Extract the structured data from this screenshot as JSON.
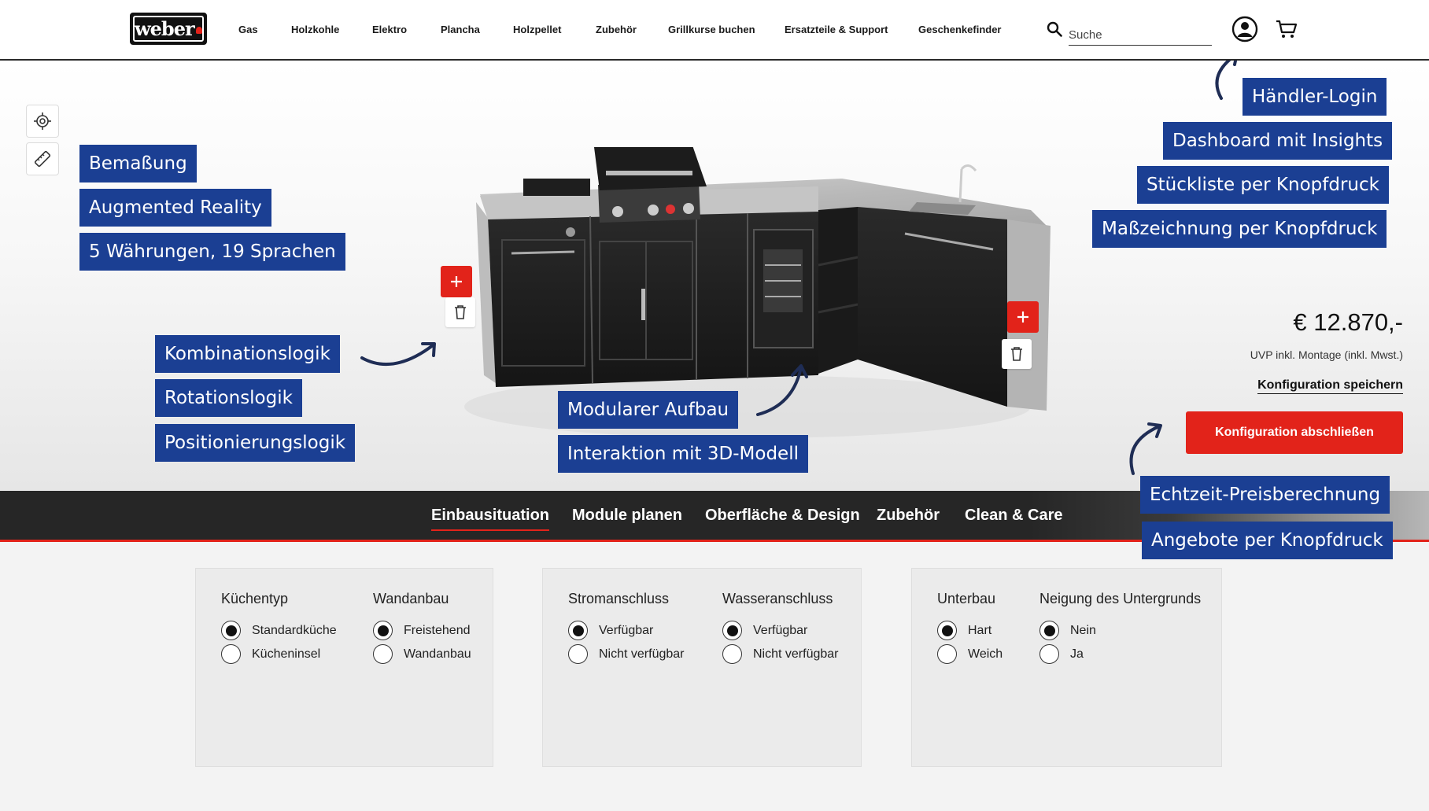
{
  "header": {
    "logo_text": "weber",
    "nav": [
      "Gas",
      "Holzkohle",
      "Elektro",
      "Plancha",
      "Holzpellet",
      "Zubehör",
      "Grillkurse buchen",
      "Ersatzteile & Support",
      "Geschenkefinder"
    ],
    "search_placeholder": "Suche",
    "icons": {
      "search": "search-icon",
      "account": "user-icon",
      "cart": "cart-icon"
    }
  },
  "tools": {
    "icons": [
      "target-icon",
      "ruler-icon"
    ]
  },
  "annotations": {
    "left": [
      "Bemaßung",
      "Augmented Reality",
      "5 Währungen, 19 Sprachen"
    ],
    "logic": [
      "Kombinationslogik",
      "Rotationslogik",
      "Positionierungslogik"
    ],
    "center": [
      "Modularer Aufbau",
      "Interaktion mit 3D-Modell"
    ],
    "right": [
      "Händler-Login",
      "Dashboard mit Insights",
      "Stückliste per Knopfdruck",
      "Maßzeichnung per Knopfdruck"
    ],
    "bottom_right": [
      "Echtzeit-Preisberechnung",
      "Angebote per Knopfdruck"
    ]
  },
  "pricing": {
    "price": "€ 12.870,-",
    "note": "UVP inkl. Montage (inkl. Mwst.)",
    "save_label": "Konfiguration speichern",
    "finish_label": "Konfiguration abschließen"
  },
  "tabs": [
    "Einbausituation",
    "Module planen",
    "Oberfläche & Design",
    "Zubehör",
    "Clean & Care"
  ],
  "active_tab": "Einbausituation",
  "panels": [
    {
      "groups": [
        {
          "title": "Küchentyp",
          "options": [
            "Standardküche",
            "Kücheninsel"
          ],
          "selected": "Standardküche"
        },
        {
          "title": "Wandanbau",
          "options": [
            "Freistehend",
            "Wandanbau"
          ],
          "selected": "Freistehend"
        }
      ]
    },
    {
      "groups": [
        {
          "title": "Stromanschluss",
          "options": [
            "Verfügbar",
            "Nicht verfügbar"
          ],
          "selected": "Verfügbar"
        },
        {
          "title": "Wasseranschluss",
          "options": [
            "Verfügbar",
            "Nicht verfügbar"
          ],
          "selected": "Verfügbar"
        }
      ]
    },
    {
      "groups": [
        {
          "title": "Unterbau",
          "options": [
            "Hart",
            "Weich"
          ],
          "selected": "Hart"
        },
        {
          "title": "Neigung des Untergrunds",
          "options": [
            "Nein",
            "Ja"
          ],
          "selected": "Nein"
        }
      ]
    }
  ],
  "colors": {
    "brand_red": "#e2231a",
    "annotation_blue": "#1b3f93",
    "arrow_navy": "#1f2d55",
    "tabbar_dark": "#262626"
  }
}
